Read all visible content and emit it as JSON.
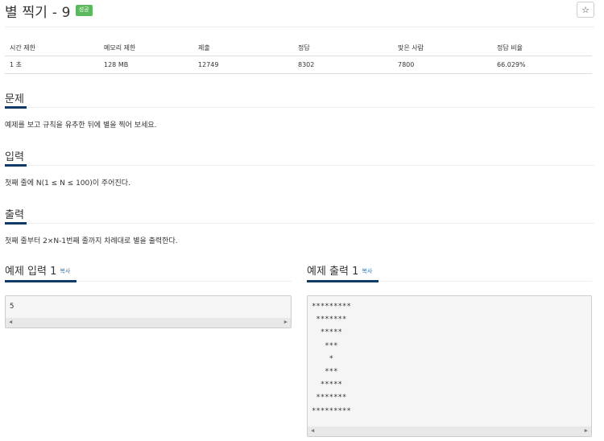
{
  "header": {
    "title": "별 찍기 - 9",
    "badge": "성공",
    "star_icon": "☆"
  },
  "info_table": {
    "columns": [
      "시간 제한",
      "메모리 제한",
      "제출",
      "정답",
      "맞은 사람",
      "정답 비율"
    ],
    "row": [
      "1 초",
      "128 MB",
      "12749",
      "8302",
      "7800",
      "66.029%"
    ]
  },
  "sections": {
    "problem": {
      "title": "문제",
      "body": "예제를 보고 규칙을 유추한 뒤에 별을 찍어 보세요."
    },
    "input": {
      "title": "입력",
      "body": "첫째 줄에 N(1 ≤ N ≤ 100)이 주어진다."
    },
    "output": {
      "title": "출력",
      "body": "첫째 줄부터 2×N-1번째 줄까지 차례대로 별을 출력한다."
    }
  },
  "samples": {
    "input": {
      "title": "예제 입력 1",
      "copy": "복사",
      "content": "5"
    },
    "output": {
      "title": "예제 출력 1",
      "copy": "복사",
      "content": "*********\n *******\n  *****\n   ***\n    *\n   ***\n  *****\n *******\n*********"
    }
  },
  "colors": {
    "badge": "#5cb85c",
    "accent_underline": "#0d3a66",
    "link": "#337ab7"
  }
}
